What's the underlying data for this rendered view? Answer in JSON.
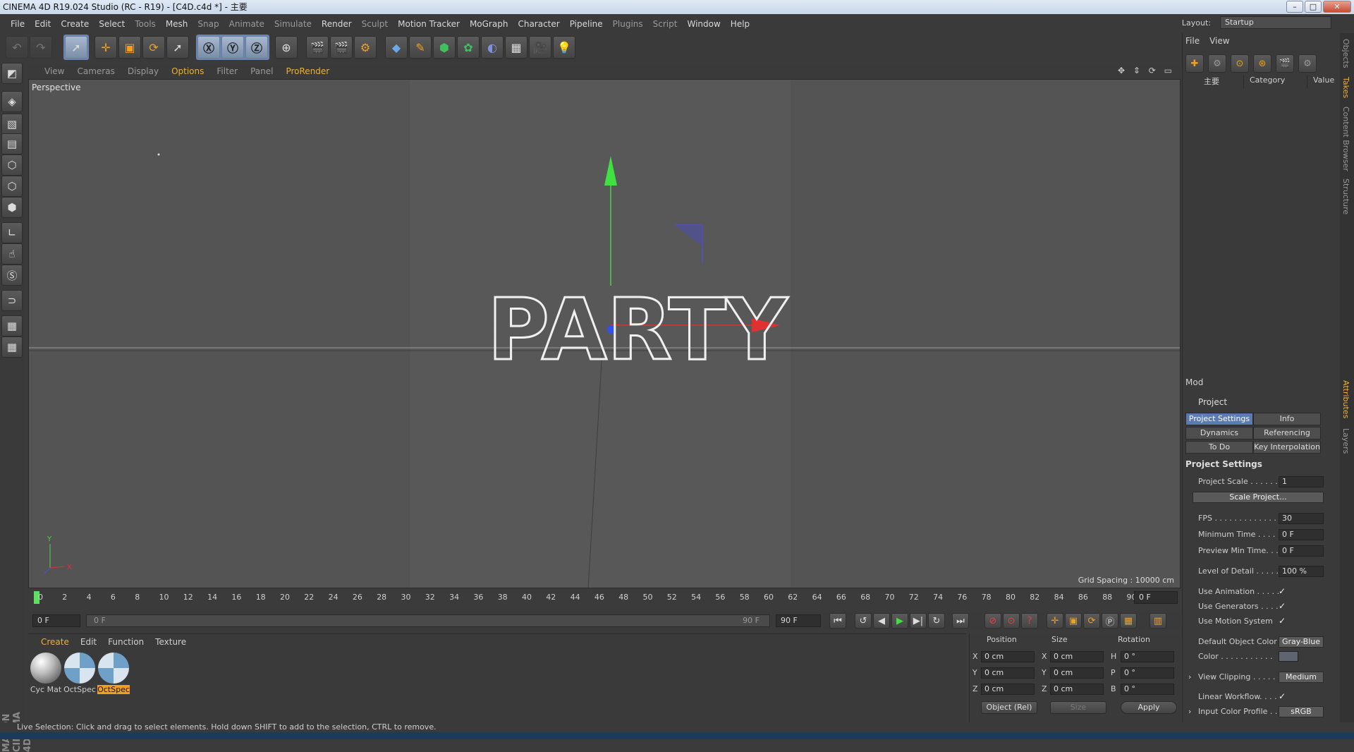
{
  "window": {
    "title": "CINEMA 4D R19.024 Studio (RC - R19) - [C4D.c4d *] - 主要"
  },
  "menu": [
    "File",
    "Edit",
    "Create",
    "Select",
    "Tools",
    "Mesh",
    "Snap",
    "Animate",
    "Simulate",
    "Render",
    "Sculpt",
    "Motion Tracker",
    "MoGraph",
    "Character",
    "Pipeline",
    "Plugins",
    "Script",
    "Window",
    "Help"
  ],
  "layout": {
    "label": "Layout:",
    "value": "Startup"
  },
  "viewport": {
    "menu": [
      "View",
      "Cameras",
      "Display",
      "Options",
      "Filter",
      "Panel",
      "ProRender"
    ],
    "active_menu": "Options",
    "label": "Perspective",
    "grid_spacing": "Grid Spacing : 10000 cm",
    "text_object": "PARTY",
    "axis_y": "Y",
    "axis_x": "X"
  },
  "timeline": {
    "ticks": [
      "0",
      "2",
      "4",
      "6",
      "8",
      "10",
      "12",
      "14",
      "16",
      "18",
      "20",
      "22",
      "24",
      "26",
      "28",
      "30",
      "32",
      "34",
      "36",
      "38",
      "40",
      "42",
      "44",
      "46",
      "48",
      "50",
      "52",
      "54",
      "56",
      "58",
      "60",
      "62",
      "64",
      "66",
      "68",
      "70",
      "72",
      "74",
      "76",
      "78",
      "80",
      "82",
      "84",
      "86",
      "88",
      "90"
    ],
    "end_field": "0 F",
    "start_field": "0 F",
    "slider_left": "0 F",
    "slider_right": "90 F",
    "max_field": "90 F"
  },
  "material_panel": {
    "menu": [
      "Create",
      "Edit",
      "Function",
      "Texture"
    ],
    "active_menu": "Create",
    "materials": [
      {
        "name": "Cyc Mat",
        "selected": false
      },
      {
        "name": "OctSpec",
        "selected": false
      },
      {
        "name": "OctSpec",
        "selected": true
      }
    ]
  },
  "coordinates": {
    "headers": {
      "position": "Position",
      "size": "Size",
      "rotation": "Rotation"
    },
    "rows": [
      {
        "pl": "X",
        "pv": "0 cm",
        "sl": "X",
        "sv": "0 cm",
        "rl": "H",
        "rv": "0 °"
      },
      {
        "pl": "Y",
        "pv": "0 cm",
        "sl": "Y",
        "sv": "0 cm",
        "rl": "P",
        "rv": "0 °"
      },
      {
        "pl": "Z",
        "pv": "0 cm",
        "sl": "Z",
        "sv": "0 cm",
        "rl": "B",
        "rv": "0 °"
      }
    ],
    "mode": "Object (Rel)",
    "size_mode": "Size",
    "apply": "Apply"
  },
  "status": "Live Selection: Click and drag to select elements. Hold down SHIFT to add to the selection, CTRL to remove.",
  "objects_panel": {
    "menu": [
      "File",
      "View"
    ],
    "columns": {
      "name": "主要",
      "category": "Category",
      "value": "Value"
    }
  },
  "right_tabs": [
    "Objects",
    "Takes",
    "Content Browser",
    "Structure",
    "Attributes",
    "Layers"
  ],
  "attributes": {
    "menu": "Mod",
    "title": "Project",
    "tabs": [
      "Project Settings",
      "Info",
      "Dynamics",
      "Referencing",
      "To Do",
      "Key Interpolation"
    ],
    "section": "Project Settings",
    "project_scale": {
      "label": "Project Scale . . . . . . .",
      "value": "1"
    },
    "scale_button": "Scale Project...",
    "fps": {
      "label": "FPS . . . . . . . . . . . . . . .",
      "value": "30"
    },
    "min_time": {
      "label": "Minimum Time . . . . .",
      "value": "0 F"
    },
    "preview_min": {
      "label": "Preview Min Time. . . .",
      "value": "0 F"
    },
    "lod": {
      "label": "Level of Detail . . . . .",
      "value": "100 %"
    },
    "use_animation": {
      "label": "Use Animation . . . . .",
      "value": "✓"
    },
    "use_generators": {
      "label": "Use Generators . . . .",
      "value": "✓"
    },
    "use_motion": {
      "label": "Use Motion System",
      "value": "✓"
    },
    "default_color": {
      "label": "Default Object Color",
      "value": "Gray-Blue"
    },
    "color": {
      "label": "Color . . . . . . . . . . ."
    },
    "view_clipping": {
      "label": "View Clipping . . . . . .",
      "value": "Medium"
    },
    "linear_workflow": {
      "label": "Linear Workflow. . . .",
      "value": "✓"
    },
    "input_profile": {
      "label": "Input Color Profile . .",
      "value": "sRGB"
    }
  }
}
